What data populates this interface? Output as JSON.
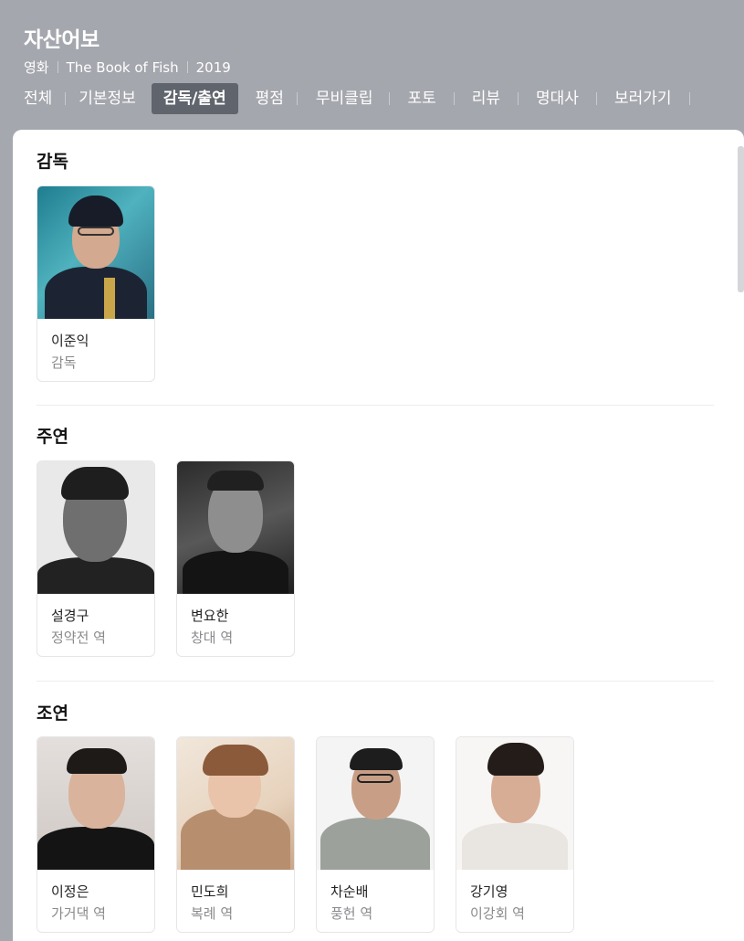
{
  "header": {
    "title": "자산어보",
    "meta": [
      "영화",
      "The Book of Fish",
      "2019"
    ]
  },
  "tabs": [
    {
      "label": "전체"
    },
    {
      "label": "기본정보"
    },
    {
      "label": "감독/출연",
      "active": true
    },
    {
      "label": "평점"
    },
    {
      "label": "무비클립"
    },
    {
      "label": "포토"
    },
    {
      "label": "리뷰"
    },
    {
      "label": "명대사"
    },
    {
      "label": "보러가기"
    }
  ],
  "sections": {
    "director": {
      "title": "감독",
      "people": [
        {
          "name": "이준익",
          "role": "감독"
        }
      ]
    },
    "lead": {
      "title": "주연",
      "people": [
        {
          "name": "설경구",
          "role": "정약전 역"
        },
        {
          "name": "변요한",
          "role": "창대 역"
        }
      ]
    },
    "supporting": {
      "title": "조연",
      "people": [
        {
          "name": "이정은",
          "role": "가거댁 역"
        },
        {
          "name": "민도희",
          "role": "복례 역"
        },
        {
          "name": "차순배",
          "role": "풍헌 역"
        },
        {
          "name": "강기영",
          "role": "이강회 역"
        }
      ]
    }
  },
  "colors": {
    "header_bg": "#a5a7ae",
    "active_tab_bg": "#5f646d"
  }
}
